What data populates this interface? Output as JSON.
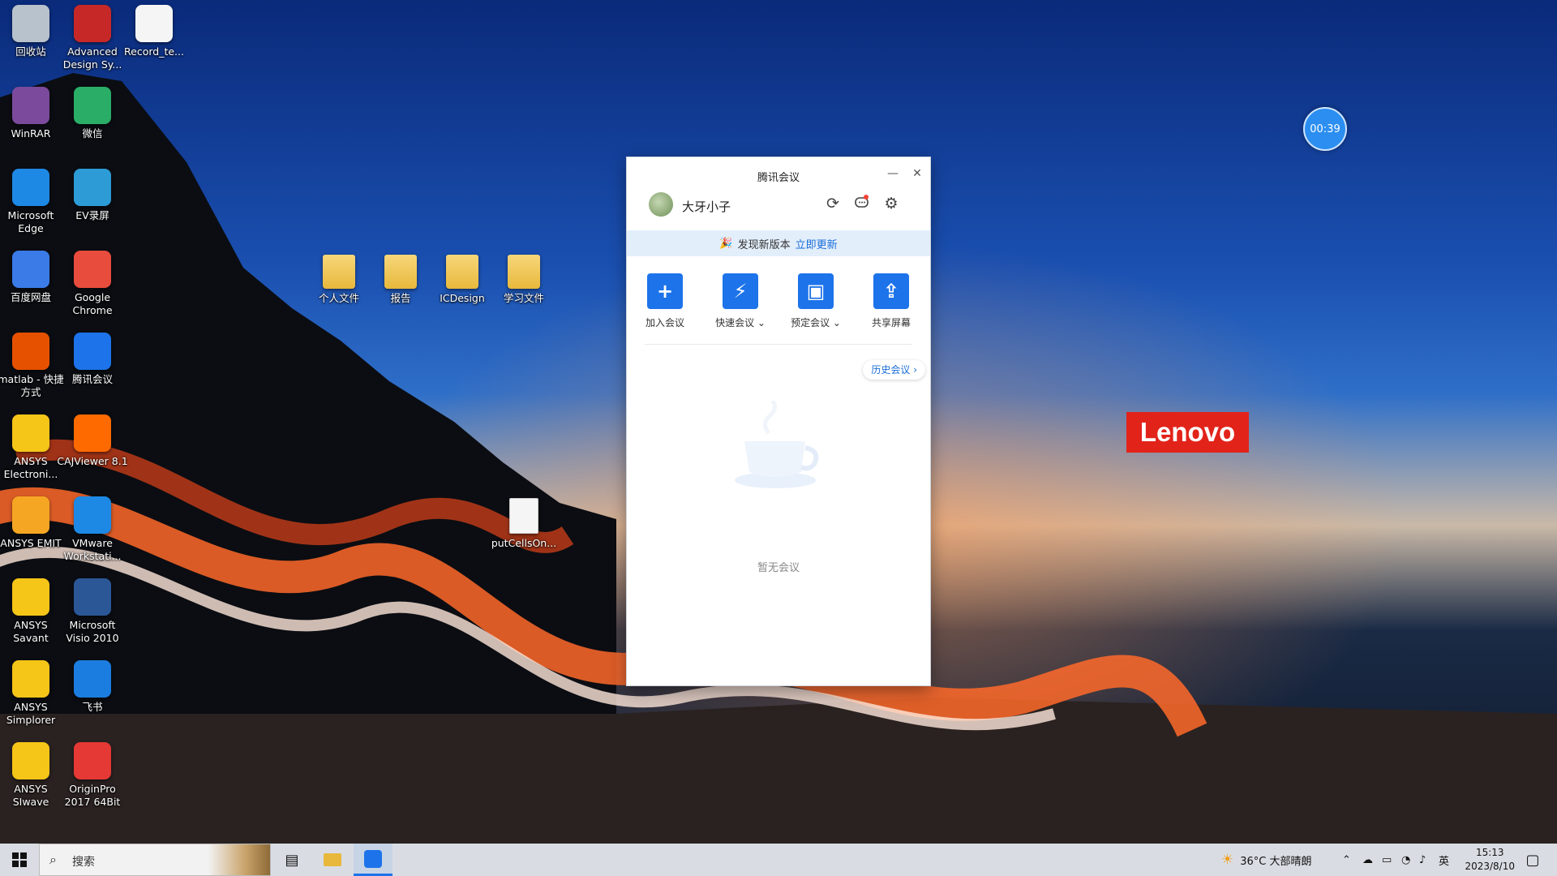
{
  "desktop_icons": [
    {
      "label": "回收站",
      "name": "recycle-bin-icon"
    },
    {
      "label": "Advanced Design Sy...",
      "name": "ads-icon"
    },
    {
      "label": "Record_te...",
      "name": "file-icon"
    },
    {
      "label": "WinRAR",
      "name": "winrar-icon"
    },
    {
      "label": "微信",
      "name": "wechat-icon"
    },
    {
      "label": "Microsoft Edge",
      "name": "edge-icon"
    },
    {
      "label": "EV录屏",
      "name": "ev-recorder-icon"
    },
    {
      "label": "百度网盘",
      "name": "baidu-netdisk-icon"
    },
    {
      "label": "Google Chrome",
      "name": "chrome-icon"
    },
    {
      "label": "matlab - 快捷方式",
      "name": "matlab-icon"
    },
    {
      "label": "腾讯会议",
      "name": "tencent-meeting-icon"
    },
    {
      "label": "ANSYS Electroni...",
      "name": "ansys-electronics-icon"
    },
    {
      "label": "CAJViewer 8.1",
      "name": "cajviewer-icon"
    },
    {
      "label": "ANSYS EMIT",
      "name": "ansys-emit-icon"
    },
    {
      "label": "VMware Workstati...",
      "name": "vmware-icon"
    },
    {
      "label": "ANSYS Savant",
      "name": "ansys-savant-icon"
    },
    {
      "label": "Microsoft Visio 2010",
      "name": "visio-icon"
    },
    {
      "label": "ANSYS Simplorer",
      "name": "ansys-simplorer-icon"
    },
    {
      "label": "飞书",
      "name": "feishu-icon"
    },
    {
      "label": "ANSYS SIwave",
      "name": "ansys-siwave-icon"
    },
    {
      "label": "OriginPro 2017 64Bit",
      "name": "originpro-icon"
    }
  ],
  "folders": [
    "个人文件",
    "报告",
    "ICDesign",
    "学习文件"
  ],
  "loose_file": "putCellsOn...",
  "lenovo_logo": "Lenovo",
  "timer": "00:39",
  "window": {
    "title": "腾讯会议",
    "minimize": "—",
    "close": "✕",
    "user_name": "大牙小子",
    "banner_text": "发现新版本",
    "banner_link": "立即更新",
    "actions": [
      {
        "label": "加入会议",
        "glyph": "+"
      },
      {
        "label": "快速会议 ⌄",
        "glyph": "⚡"
      },
      {
        "label": "预定会议 ⌄",
        "glyph": "▣"
      },
      {
        "label": "共享屏幕",
        "glyph": "⇪"
      }
    ],
    "history_button": "历史会议 ›",
    "empty_text": "暂无会议"
  },
  "taskbar": {
    "search_placeholder": "搜索",
    "weather": "36°C  大部晴朗",
    "ime": "英",
    "time": "15:13",
    "date": "2023/8/10"
  },
  "colors": {
    "accent": "#1d73ea",
    "lenovo": "#e2231a",
    "banner": "#e3eefb"
  }
}
